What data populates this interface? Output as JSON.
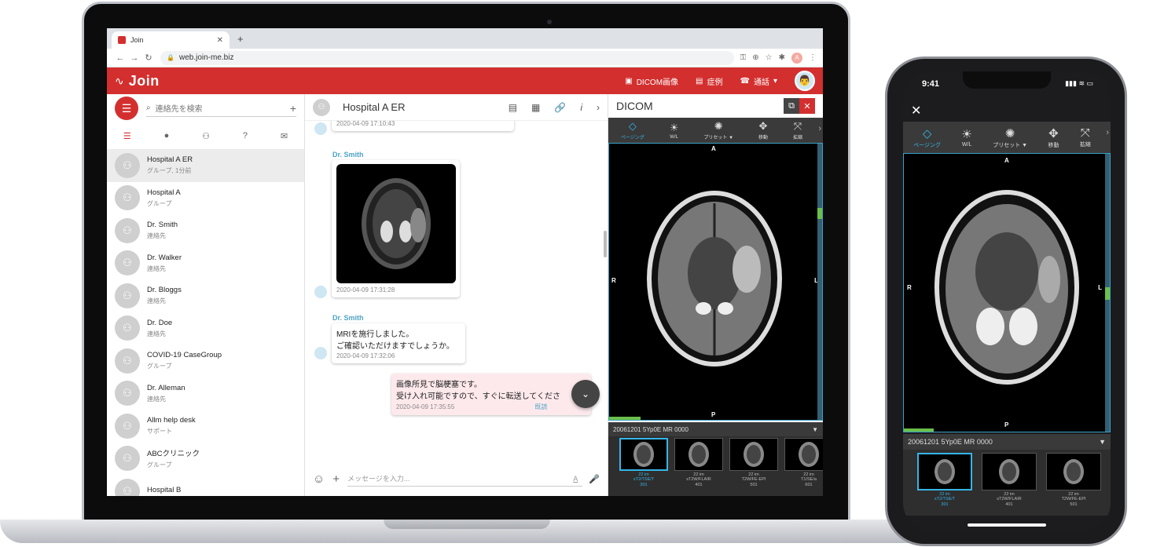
{
  "browser": {
    "tab_title": "Join",
    "url": "web.join-me.biz"
  },
  "app": {
    "brand": "Join",
    "header_actions": {
      "dicom": "DICOM画像",
      "cases": "症例",
      "call": "通話"
    }
  },
  "sidebar": {
    "search_placeholder": "連絡先を検索",
    "contacts": [
      {
        "name": "Hospital A ER",
        "sub": "グループ, 1分前",
        "selected": true
      },
      {
        "name": "Hospital A",
        "sub": "グループ"
      },
      {
        "name": "Dr. Smith",
        "sub": "連絡先"
      },
      {
        "name": "Dr. Walker",
        "sub": "連絡先"
      },
      {
        "name": "Dr. Bloggs",
        "sub": "連絡先"
      },
      {
        "name": "Dr. Doe",
        "sub": "連絡先"
      },
      {
        "name": "COVID-19 CaseGroup",
        "sub": "グループ"
      },
      {
        "name": "Dr. Alleman",
        "sub": "連絡先"
      },
      {
        "name": "Allm help desk",
        "sub": "サポート"
      },
      {
        "name": "ABCクリニック",
        "sub": "グループ"
      },
      {
        "name": "Hospital B",
        "sub": ""
      }
    ]
  },
  "chat": {
    "title": "Hospital A ER",
    "messages": [
      {
        "time": "2020-04-09 17:10:43"
      },
      {
        "sender": "Dr. Smith",
        "time": "2020-04-09 17:31:28"
      },
      {
        "sender": "Dr. Smith",
        "line1": "MRIを施行しました。",
        "line2": "ご確認いただけますでしょうか。",
        "time": "2020-04-09 17:32:06"
      },
      {
        "line1": "画像所見で脳梗塞です。",
        "line2": "受け入れ可能ですので、すぐに転送してくださ",
        "time": "2020-04-09 17:35:55",
        "read": "既読"
      }
    ],
    "composer_placeholder": "メッセージを入力..."
  },
  "dicom": {
    "title": "DICOM",
    "tools": [
      {
        "icon": "paging-icon",
        "label": "ページング",
        "active": true
      },
      {
        "icon": "brightness-icon",
        "label": "W/L"
      },
      {
        "icon": "preset-icon",
        "label": "プリセット ▼"
      },
      {
        "icon": "move-icon",
        "label": "移動"
      },
      {
        "icon": "zoom-icon",
        "label": "拡縮"
      }
    ],
    "orientation": {
      "top": "A",
      "bottom": "P",
      "left": "R",
      "right": "L"
    },
    "series_label": "20061201 5Yp0E MR 0000",
    "thumbnails": [
      {
        "line1": "22 im",
        "line2": "sT2/TSE/T",
        "line3": "301",
        "active": true
      },
      {
        "line1": "22 im",
        "line2": "sT2W/FLAIR",
        "line3": "401"
      },
      {
        "line1": "22 im",
        "line2": "T2W/FE-EPI",
        "line3": "501"
      },
      {
        "line1": "22 im",
        "line2": "T1/SE/a",
        "line3": "601"
      }
    ]
  },
  "phone": {
    "time": "9:41",
    "series_label": "20061201 5Yp0E MR 0000",
    "thumbnails": [
      {
        "line1": "22 im",
        "line2": "sT2/TSE/T",
        "line3": "301",
        "active": true
      },
      {
        "line1": "22 im",
        "line2": "sT2W/FLAIR",
        "line3": "401"
      },
      {
        "line1": "22 im",
        "line2": "T2W/FE-EPI",
        "line3": "501"
      }
    ]
  },
  "colors": {
    "brand_red": "#d32f2f",
    "accent_blue": "#35b6e8"
  }
}
